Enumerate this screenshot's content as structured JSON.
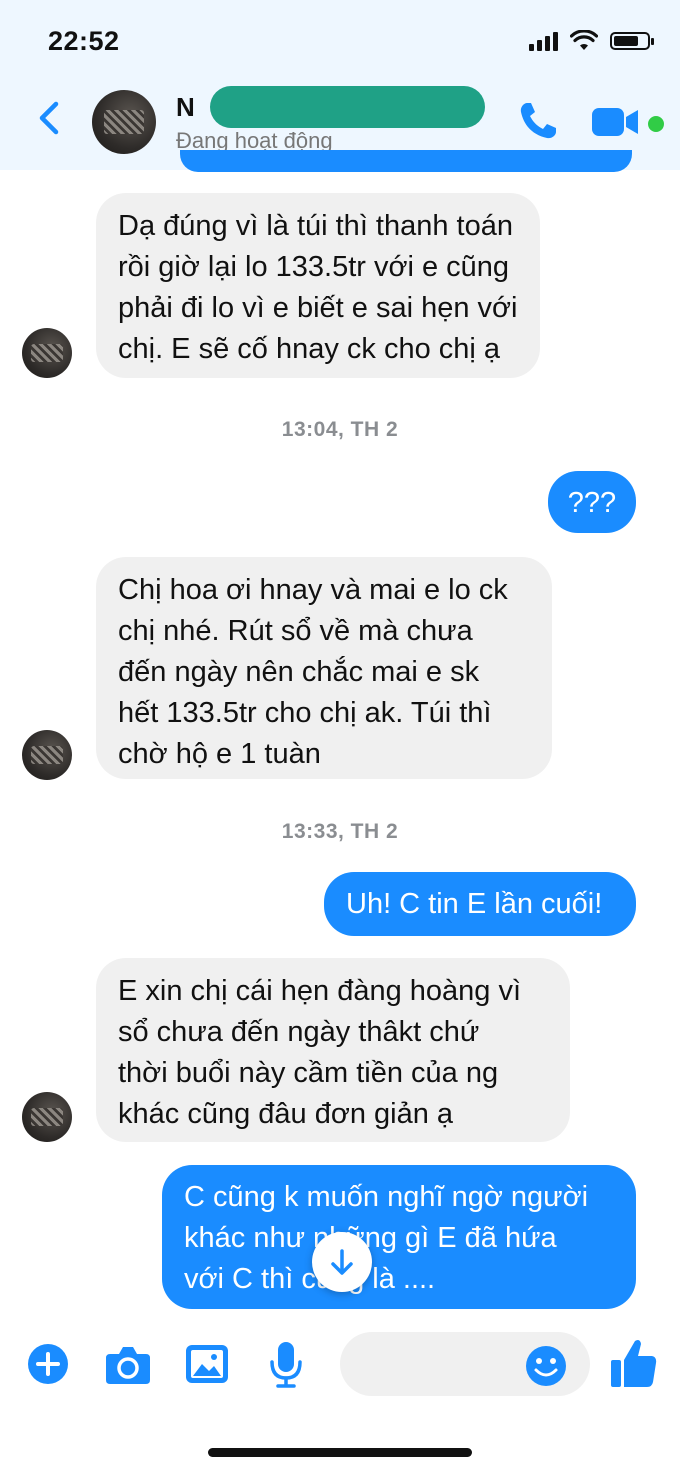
{
  "status_bar": {
    "time": "22:52"
  },
  "header": {
    "contact_name": "N",
    "contact_status": "Đang hoạt động"
  },
  "messages": [
    {
      "direction": "in",
      "text": "Dạ đúng vì là túi thì thanh toán\nrồi giờ lại lo 133.5tr với e cũng\nphải đi lo vì e biết e sai hẹn với\nchị. E sẽ cố hnay ck cho chị ạ"
    },
    {
      "timestamp": "13:04, TH 2"
    },
    {
      "direction": "out",
      "text": "???"
    },
    {
      "direction": "in",
      "text": "Chị hoa ơi hnay và mai e lo ck\nchị nhé. Rút sổ về mà chưa\nđến ngày nên chắc mai e sk\nhết 133.5tr cho chị ak. Túi thì\nchờ hộ e 1 tuàn"
    },
    {
      "timestamp": "13:33, TH 2"
    },
    {
      "direction": "out",
      "text": "Uh! C tin E lần cuối!"
    },
    {
      "direction": "in",
      "text": "E xin chị cái hẹn đàng hoàng vì\nsổ chưa đến ngày thâkt chứ\nthời buổi này cầm tiền của ng\nkhác cũng đâu đơn giản ạ"
    },
    {
      "direction": "out",
      "text": "C cũng k muốn nghĩ ngờ người\nkhác như    những gì E đã hứa\nvới C thì cũng là ...."
    }
  ],
  "composer": {
    "placeholder": ""
  },
  "colors": {
    "accent": "#1a8cff",
    "incoming_bubble": "#f0f0f0",
    "online": "#31cc46",
    "header_bg": "#eef7ff"
  }
}
